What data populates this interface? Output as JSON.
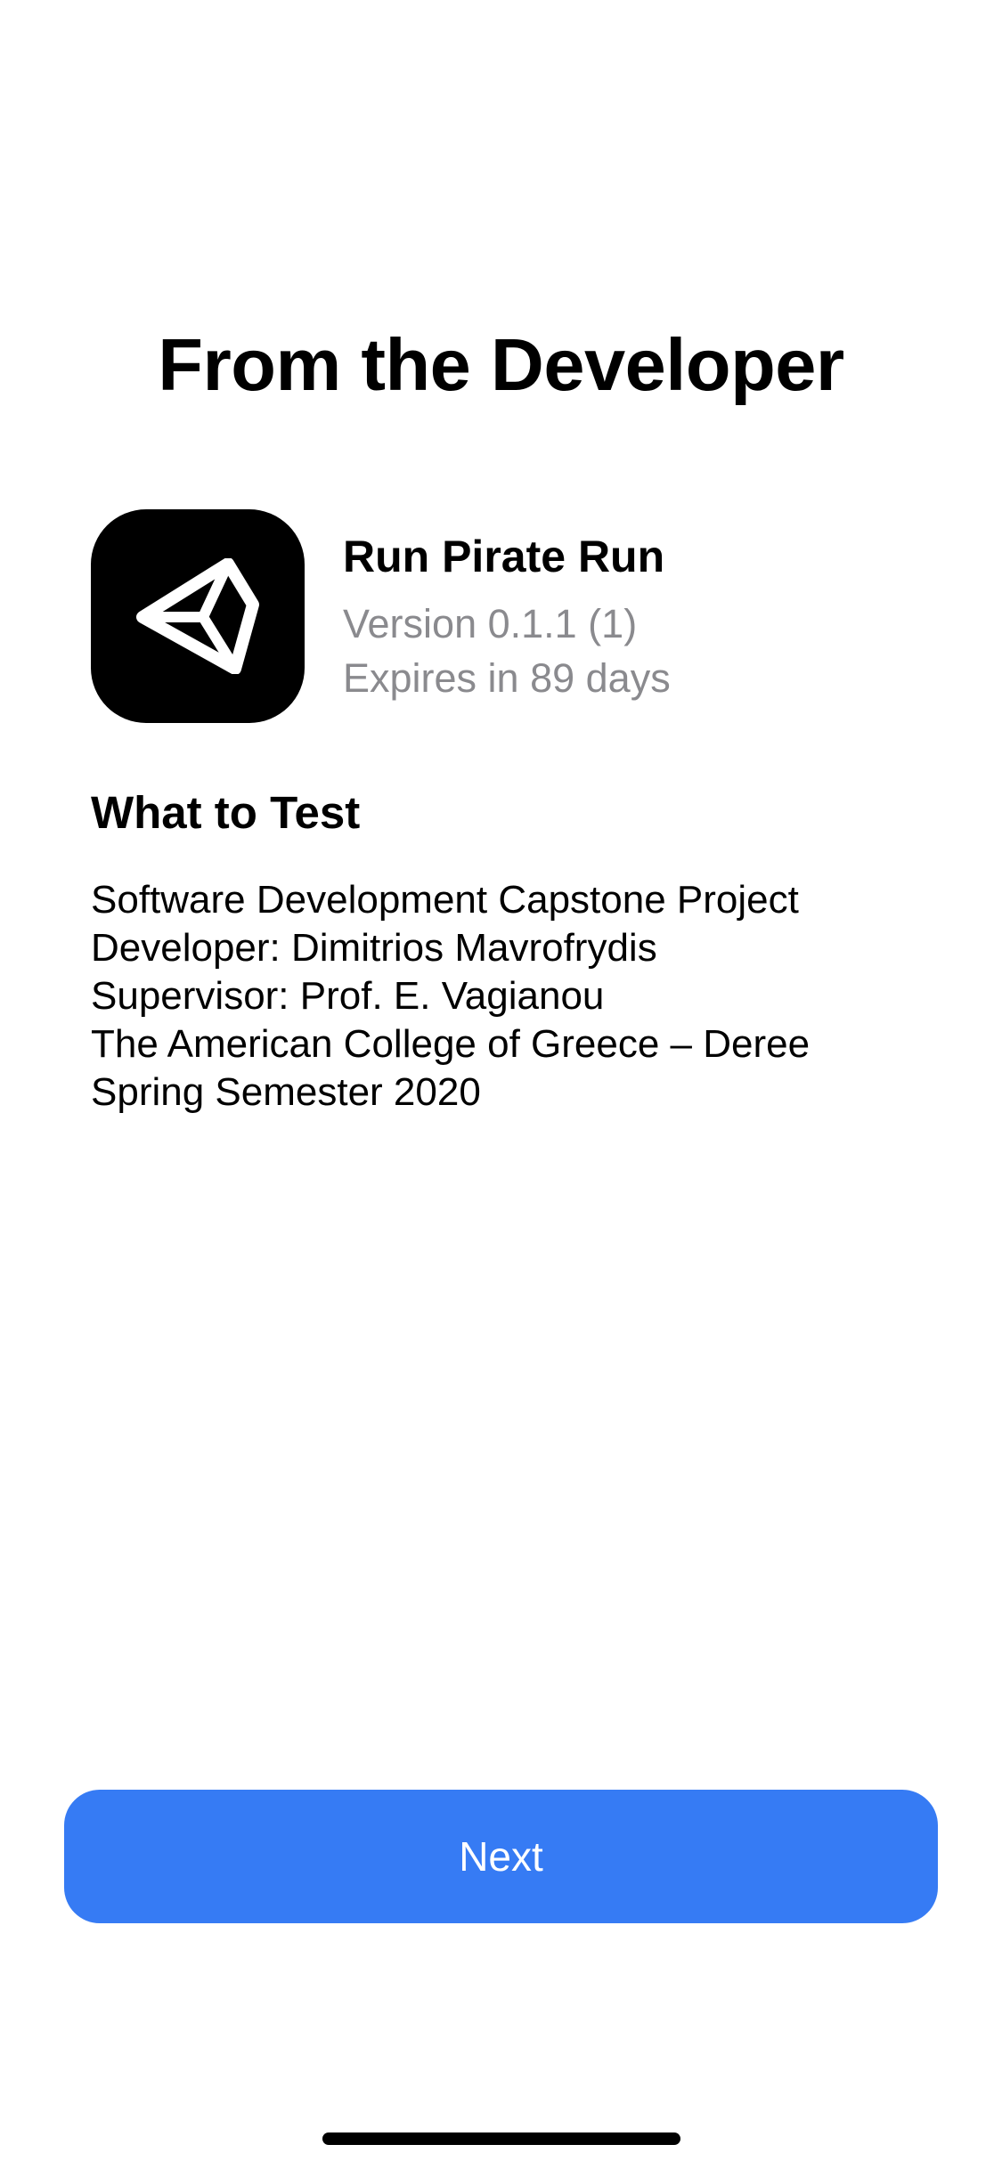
{
  "header": {
    "title": "From the Developer"
  },
  "app": {
    "icon": "unity-logo-icon",
    "name": "Run Pirate Run",
    "version": "Version 0.1.1 (1)",
    "expiry": "Expires in 89 days"
  },
  "what_to_test": {
    "heading": "What to Test",
    "lines": [
      "Software Development Capstone Project",
      "Developer: Dimitrios Mavrofrydis",
      "Supervisor: Prof. E. Vagianou",
      "The American College of Greece – Deree",
      "Spring Semester 2020"
    ]
  },
  "footer": {
    "next_label": "Next"
  },
  "colors": {
    "accent": "#367bf4",
    "secondary_text": "#8a8a8e",
    "background": "#ffffff",
    "icon_background": "#000000"
  }
}
